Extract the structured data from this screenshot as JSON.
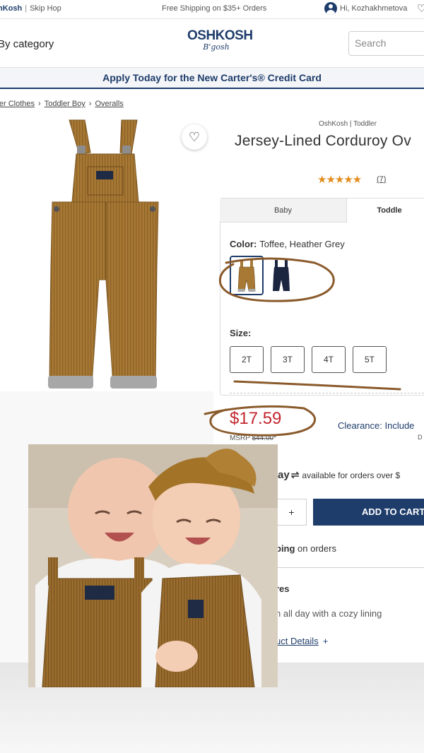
{
  "topbar": {
    "brand1": "hKosh",
    "separator": "|",
    "brand2": "Skip Hop",
    "shipping": "Free Shipping on $35+ Orders",
    "greeting": "Hi, Kozhakhmetova"
  },
  "header": {
    "shop_category": "By category",
    "logo_line1": "OSHKOSH",
    "logo_line2": "B'gosh",
    "search_placeholder": "Search"
  },
  "promo": {
    "text": "Apply Today for the New Carter's® Credit Card"
  },
  "breadcrumb": [
    "ller Clothes",
    "Toddler Boy",
    "Overalls"
  ],
  "product": {
    "brand_line": "OshKosh | Toddler",
    "title": "Jersey-Lined Corduroy Ov",
    "stars": "★★★★★",
    "rating_value": 5,
    "review_count": "(7)",
    "tabs": [
      "Baby",
      "Toddle"
    ],
    "color_label": "Color:",
    "color_value": "Toffee, Heather Grey",
    "swatches": [
      "toffee-overalls",
      "navy-overalls"
    ],
    "size_label": "Size:",
    "sizes": [
      "2T",
      "3T",
      "4T",
      "5T"
    ],
    "price": "$17.59",
    "msrp_label": "MSRP",
    "msrp_value": "$44.00",
    "msrp_mark": "*",
    "clearance": "Clearance: Include",
    "clearance_sub": "D",
    "afterpay_brand": "rpay",
    "afterpay_text": "available for orders over $",
    "qty_plus": "+",
    "add_to_cart": "ADD TO CART",
    "shipping_bold": "ping",
    "shipping_rest": " on orders",
    "features_heading": "res",
    "feature_text": "n all day with a cozy lining",
    "product_details": "uct Details",
    "product_details_plus": "+"
  },
  "colors": {
    "navy": "#1f3d6b",
    "price_red": "#c2262e",
    "star_orange": "#e38d1c",
    "annotation_brown": "#8a5a2b",
    "corduroy": "#a87934"
  }
}
